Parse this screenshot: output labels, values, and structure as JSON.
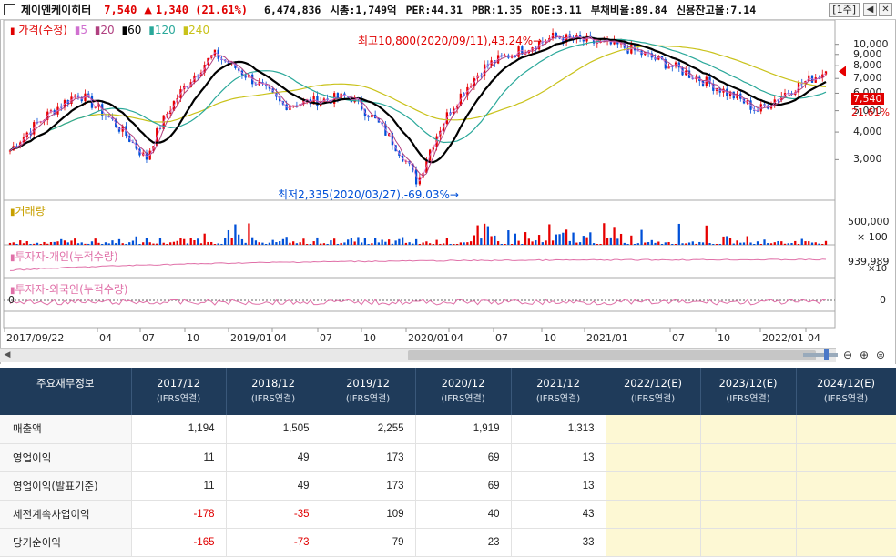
{
  "header": {
    "stock_name": "제이엔케이히터",
    "price": "7,540",
    "change_arrow": "▲",
    "change": "1,340",
    "change_pct": "(21.61%)",
    "volume": "6,474,836",
    "market_cap": "시총:1,749억",
    "per": "PER:44.31",
    "pbr": "PBR:1.35",
    "roe": "ROE:3.11",
    "debt_ratio": "부채비율:89.84",
    "credit_ratio": "신용잔고율:7.14",
    "period": "[1주]",
    "btn_prev": "◀",
    "btn_close": "✕"
  },
  "chart": {
    "price_legend": {
      "title": "가격(수정)",
      "ma5": "5",
      "ma20": "20",
      "ma60": "60",
      "ma120": "120",
      "ma240": "240"
    },
    "annotations": {
      "high": "최고10,800(2020/09/11),43.24%→",
      "low": "최저2,335(2020/03/27),-69.03%→"
    },
    "price_axis_ticks": [
      "10,000",
      "9,000",
      "8,000",
      "7,000",
      "6,000",
      "5,000",
      "4,000",
      "3,000"
    ],
    "last_price_tag": "7,540",
    "last_pct_tag": "21.61%",
    "volume_label": "거래량",
    "volume_axis": "500,000",
    "volume_unit": "× 100",
    "individual_label": "투자자-개인(누적수량)",
    "individual_axis": "939,989",
    "individual_unit": "×10",
    "foreign_label": "투자자-외국인(누적수량)",
    "foreign_axis": "0",
    "foreign_zero": "0",
    "date_ticks": [
      "2017/09/22",
      "04",
      "07",
      "10",
      "2019/01",
      "04",
      "07",
      "10",
      "2020/01",
      "04",
      "07",
      "10",
      "2021/01",
      "07",
      "10",
      "2022/01",
      "04"
    ],
    "colors": {
      "up": "#e60000",
      "down": "#0050d8",
      "ma5": "#d070d0",
      "ma20": "#b04080",
      "ma60": "#000000",
      "ma120": "#2aa89a",
      "ma240": "#c9c21a"
    }
  },
  "chart_data": {
    "type": "candlestick",
    "title": "제이엔케이히터",
    "period": "weekly",
    "ylim": [
      2000,
      11500
    ],
    "key_points": [
      {
        "date": "2017/09/22",
        "price": 3300
      },
      {
        "date": "2018/04",
        "price": 6000
      },
      {
        "date": "2018/10",
        "price": 3000
      },
      {
        "date": "2019/02",
        "price": 9000
      },
      {
        "date": "2019/07",
        "price": 5300
      },
      {
        "date": "2019/10",
        "price": 5800
      },
      {
        "date": "2020/03/27",
        "price": 2335
      },
      {
        "date": "2020/07",
        "price": 8000
      },
      {
        "date": "2020/09/11",
        "price": 10800
      },
      {
        "date": "2021/01",
        "price": 9800
      },
      {
        "date": "2021/07",
        "price": 7300
      },
      {
        "date": "2022/01",
        "price": 5000
      },
      {
        "date": "2022/04",
        "price": 7540
      }
    ]
  },
  "table": {
    "header_label": "주요재무정보",
    "columns": [
      {
        "period": "2017/12",
        "basis": "(IFRS연결)"
      },
      {
        "period": "2018/12",
        "basis": "(IFRS연결)"
      },
      {
        "period": "2019/12",
        "basis": "(IFRS연결)"
      },
      {
        "period": "2020/12",
        "basis": "(IFRS연결)"
      },
      {
        "period": "2021/12",
        "basis": "(IFRS연결)"
      },
      {
        "period": "2022/12(E)",
        "basis": "(IFRS연결)"
      },
      {
        "period": "2023/12(E)",
        "basis": "(IFRS연결)"
      },
      {
        "period": "2024/12(E)",
        "basis": "(IFRS연결)"
      }
    ],
    "rows": [
      {
        "label": "매출액",
        "values": [
          "1,194",
          "1,505",
          "2,255",
          "1,919",
          "1,313",
          "",
          "",
          ""
        ]
      },
      {
        "label": "영업이익",
        "values": [
          "11",
          "49",
          "173",
          "69",
          "13",
          "",
          "",
          ""
        ]
      },
      {
        "label": "영업이익(발표기준)",
        "values": [
          "11",
          "49",
          "173",
          "69",
          "13",
          "",
          "",
          ""
        ]
      },
      {
        "label": "세전계속사업이익",
        "values": [
          "-178",
          "-35",
          "109",
          "40",
          "43",
          "",
          "",
          ""
        ]
      },
      {
        "label": "당기순이익",
        "values": [
          "-165",
          "-73",
          "79",
          "23",
          "33",
          "",
          "",
          ""
        ]
      }
    ]
  }
}
